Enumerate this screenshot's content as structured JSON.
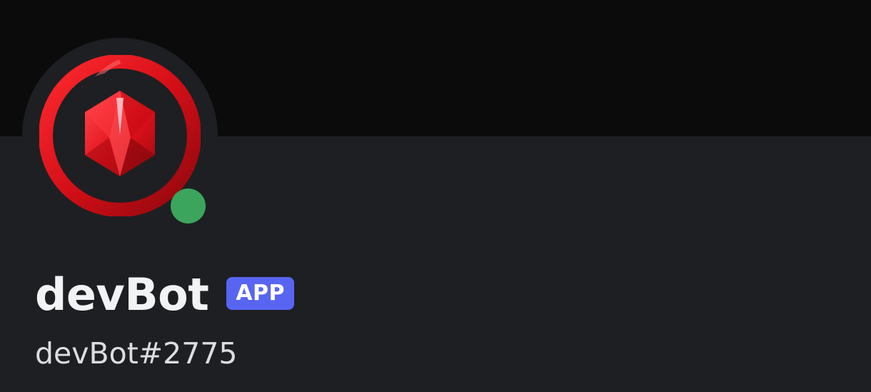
{
  "profile": {
    "display_name": "devBot",
    "badge": "APP",
    "username": "devBot#2775",
    "status": "online"
  },
  "colors": {
    "banner": "#0b0b0c",
    "background": "#1e1f22",
    "status_online": "#3ba55d",
    "badge_bg": "#5865f2",
    "avatar_red": "#e0131c"
  },
  "icons": {
    "avatar": "red-gem-ring-avatar",
    "status": "online-status-dot"
  }
}
